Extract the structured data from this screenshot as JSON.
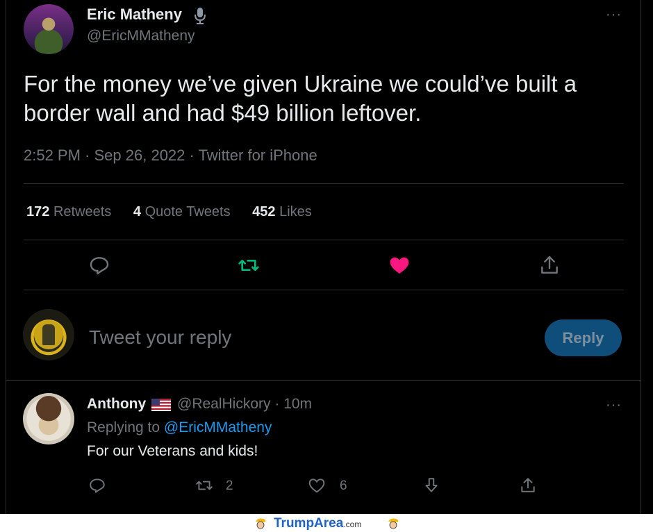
{
  "tweet": {
    "author_name": "Eric Matheny",
    "author_handle": "@EricMMatheny",
    "text": "For the money we’ve given Ukraine we could’ve built a border wall and had $49 billion leftover.",
    "time": "2:52 PM",
    "date": "Sep 26, 2022",
    "source": "Twitter for iPhone",
    "more_label": "···"
  },
  "stats": {
    "retweets_count": "172",
    "retweets_label": "Retweets",
    "quotes_count": "4",
    "quotes_label": "Quote Tweets",
    "likes_count": "452",
    "likes_label": "Likes"
  },
  "actions": {
    "icons": [
      "reply-icon",
      "retweet-icon",
      "like-icon",
      "share-icon"
    ],
    "retweet_color": "#00ba7c",
    "like_color": "#f91880"
  },
  "compose": {
    "placeholder": "Tweet your reply",
    "reply_button": "Reply"
  },
  "reply": {
    "author_name": "Anthony",
    "flag_icon": "us-flag-icon",
    "author_handle": "@RealHickory",
    "age": "10m",
    "replying_prefix": "Replying to",
    "replying_to": "@EricMMatheny",
    "text": "For our Veterans and kids!",
    "retweet_count": "2",
    "like_count": "6",
    "more_label": "···"
  },
  "watermark": {
    "brand": "TrumpArea",
    "suffix": ".com"
  },
  "colors": {
    "background": "#000000",
    "text": "#e7e9ea",
    "muted": "#71767b",
    "accent": "#1d9bf0",
    "divider": "#2f3336"
  }
}
